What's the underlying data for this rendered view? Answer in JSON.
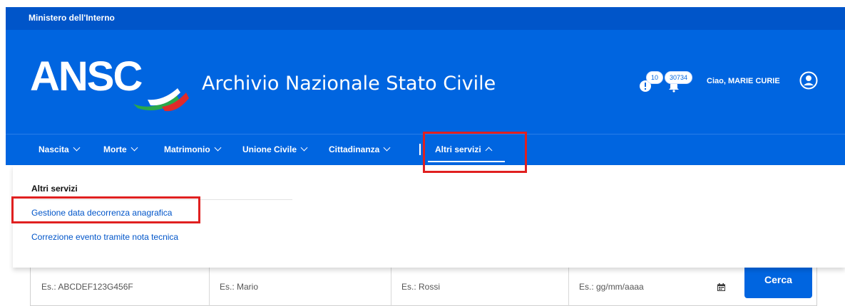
{
  "top_strip": {
    "ministry": "Ministero dell'Interno"
  },
  "header": {
    "logo_text": "ANSC",
    "title": "Archivio Nazionale Stato Civile",
    "notifications": [
      {
        "badge": "10",
        "icon": "alert-bell-icon"
      },
      {
        "badge": "30734",
        "icon": "bell-icon"
      }
    ],
    "greeting": "Ciao,  MARIE CURIE",
    "user_icon": "user-circle-icon"
  },
  "nav": {
    "items": [
      {
        "label": "Nascita"
      },
      {
        "label": "Morte"
      },
      {
        "label": "Matrimonio"
      },
      {
        "label": "Unione Civile"
      },
      {
        "label": "Cittadinanza"
      },
      {
        "label": "Altri servizi"
      }
    ]
  },
  "dropdown": {
    "header": "Altri servizi",
    "links": [
      "Gestione data decorrenza anagrafica",
      "Correzione evento tramite nota tecnica"
    ]
  },
  "search_form": {
    "placeholders": [
      "Es.: ABCDEF123G456F",
      "Es.: Mario",
      "Es.: Rossi",
      "Es.: gg/mm/aaaa"
    ],
    "button": "Cerca"
  },
  "colors": {
    "brand_blue": "#0065e0",
    "dark_blue": "#0055c9",
    "highlight_red": "#e02020",
    "link_blue": "#0055c9"
  }
}
